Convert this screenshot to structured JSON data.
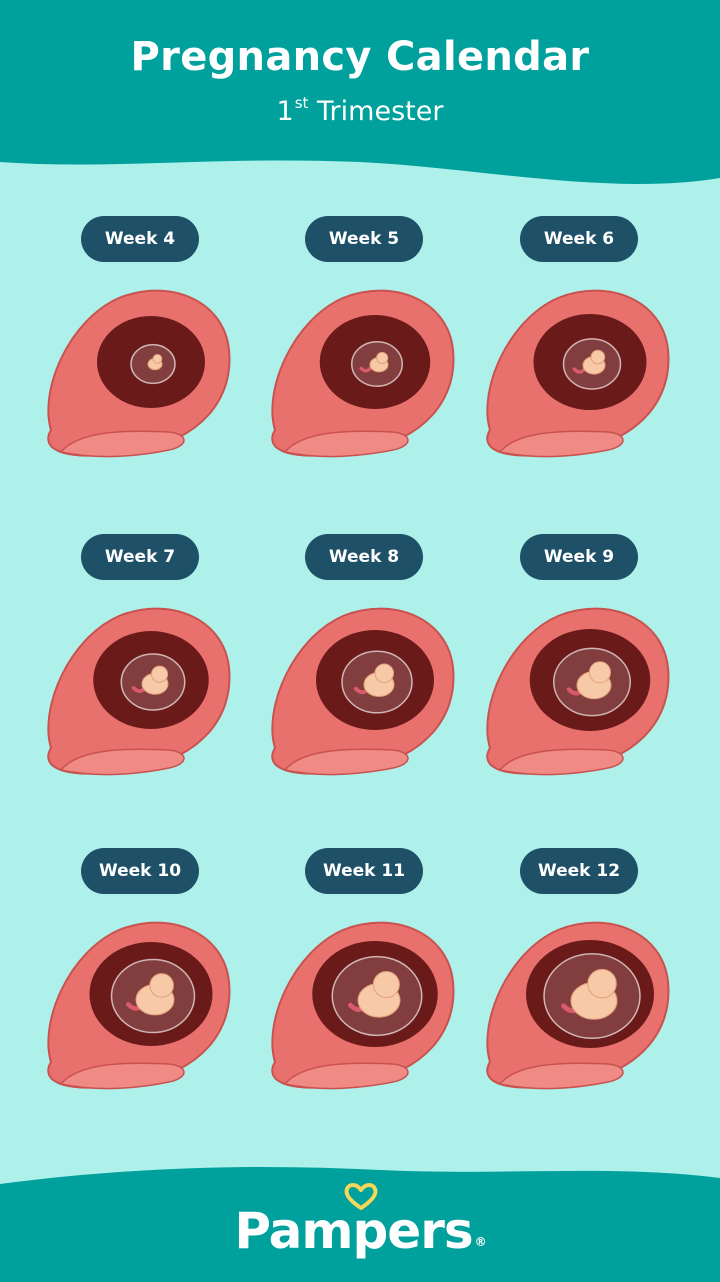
{
  "header": {
    "title": "Pregnancy Calendar",
    "subtitle_number": "1",
    "subtitle_suffix": "st",
    "subtitle_text": "Trimester"
  },
  "weeks": [
    {
      "label": "Week 4",
      "embryo": "embryo-week-4-icon"
    },
    {
      "label": "Week 5",
      "embryo": "embryo-week-5-icon"
    },
    {
      "label": "Week 6",
      "embryo": "embryo-week-6-icon"
    },
    {
      "label": "Week 7",
      "embryo": "embryo-week-7-icon"
    },
    {
      "label": "Week 8",
      "embryo": "embryo-week-8-icon"
    },
    {
      "label": "Week 9",
      "embryo": "embryo-week-9-icon"
    },
    {
      "label": "Week 10",
      "embryo": "embryo-week-10-icon"
    },
    {
      "label": "Week 11",
      "embryo": "embryo-week-11-icon"
    },
    {
      "label": "Week 12",
      "embryo": "embryo-week-12-icon"
    }
  ],
  "footer": {
    "brand": "Pampers",
    "registered_mark": "®"
  },
  "colors": {
    "background": "#aef0ea",
    "banner": "#00a19c",
    "pill": "#1e5068",
    "uterus_wall": "#e8716e",
    "uterus_cavity": "#6b1a1a",
    "embryo": "#f7c9a6",
    "logo_heart": "#f5d75a"
  }
}
